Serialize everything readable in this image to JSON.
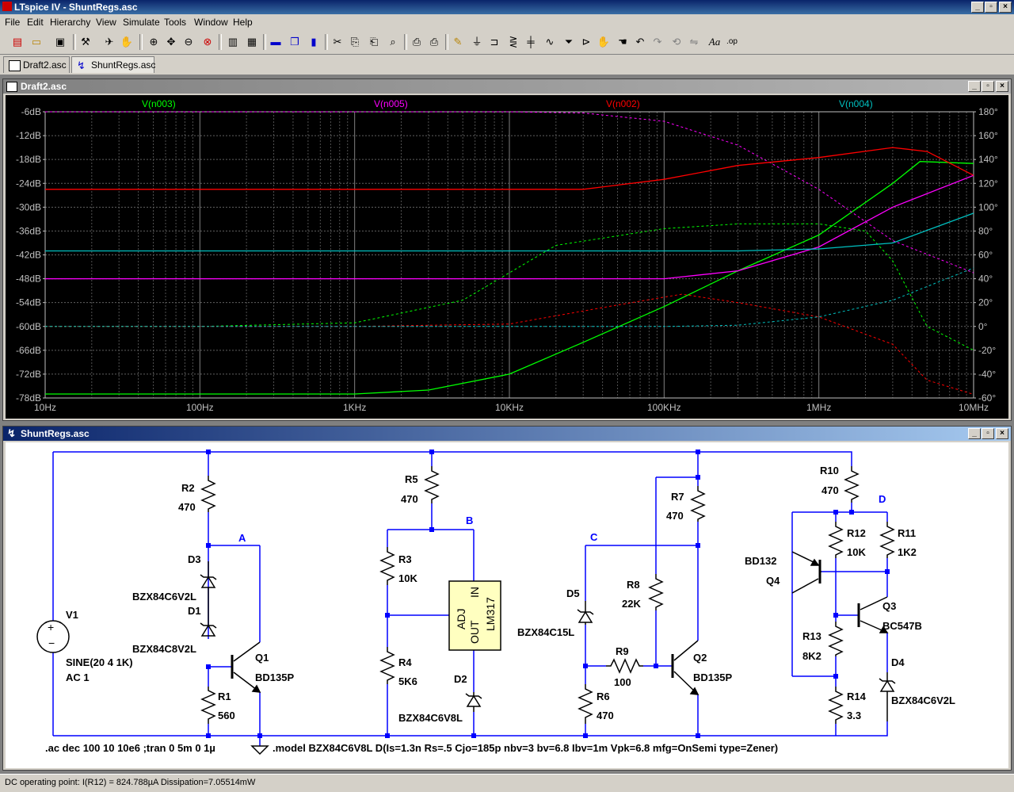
{
  "app": {
    "title": "LTspice IV - ShuntRegs.asc"
  },
  "menu": [
    "File",
    "Edit",
    "Hierarchy",
    "View",
    "Simulate",
    "Tools",
    "Window",
    "Help"
  ],
  "tabs": [
    {
      "label": "Draft2.asc",
      "icon": "waveform-icon"
    },
    {
      "label": "ShuntRegs.asc",
      "icon": "schematic-icon"
    }
  ],
  "plot_window": {
    "title": "Draft2.asc",
    "traces": [
      {
        "label": "V(n003)",
        "color": "#00ff00"
      },
      {
        "label": "V(n005)",
        "color": "#ff00ff"
      },
      {
        "label": "V(n002)",
        "color": "#ff0000"
      },
      {
        "label": "V(n004)",
        "color": "#00c0c0"
      }
    ]
  },
  "chart_data": {
    "type": "line",
    "xscale": "log",
    "xlim": [
      10,
      10000000
    ],
    "x_ticks": [
      "10Hz",
      "100Hz",
      "1KHz",
      "10KHz",
      "100KHz",
      "1MHz",
      "10MHz"
    ],
    "y_left_ticks": [
      "-6dB",
      "-12dB",
      "-18dB",
      "-24dB",
      "-30dB",
      "-36dB",
      "-42dB",
      "-48dB",
      "-54dB",
      "-60dB",
      "-66dB",
      "-72dB",
      "-78dB"
    ],
    "y_left_lim": [
      -78,
      -6
    ],
    "y_right_ticks": [
      "180°",
      "160°",
      "140°",
      "120°",
      "100°",
      "80°",
      "60°",
      "40°",
      "20°",
      "0°",
      "-20°",
      "-40°",
      "-60°"
    ],
    "y_right_lim": [
      -60,
      180
    ],
    "series": [
      {
        "name": "V(n003)",
        "color": "#00ff00",
        "style": "solid",
        "axis": "dB",
        "x": [
          10,
          1000,
          3000,
          10000,
          30000,
          100000,
          300000,
          1000000,
          3000000,
          4500000,
          10000000
        ],
        "y": [
          -77,
          -77,
          -76,
          -72,
          -64,
          -55,
          -46,
          -37,
          -24,
          -18.5,
          -19
        ]
      },
      {
        "name": "V(n003)",
        "color": "#00ff00",
        "style": "dashed",
        "axis": "deg",
        "x": [
          10,
          100,
          1000,
          5000,
          20000,
          100000,
          300000,
          1000000,
          2000000,
          3000000,
          5000000,
          10000000
        ],
        "y": [
          0,
          0,
          3,
          22,
          68,
          82,
          86,
          86,
          80,
          55,
          0,
          -20
        ]
      },
      {
        "name": "V(n005)",
        "color": "#ff00ff",
        "style": "solid",
        "axis": "dB",
        "x": [
          10,
          100000,
          300000,
          1000000,
          3000000,
          10000000
        ],
        "y": [
          -48,
          -48,
          -46,
          -40,
          -30,
          -22
        ]
      },
      {
        "name": "V(n005)",
        "color": "#ff00ff",
        "style": "dashed",
        "axis": "deg",
        "x": [
          10,
          1000,
          10000,
          30000,
          100000,
          300000,
          1000000,
          3000000,
          10000000
        ],
        "y": [
          180,
          180,
          180,
          179,
          172,
          152,
          115,
          72,
          45
        ]
      },
      {
        "name": "V(n002)",
        "color": "#ff0000",
        "style": "solid",
        "axis": "dB",
        "x": [
          10,
          30000,
          100000,
          300000,
          1000000,
          3000000,
          5000000,
          10000000
        ],
        "y": [
          -25.5,
          -25.5,
          -23,
          -19.5,
          -17.5,
          -15,
          -16,
          -22
        ]
      },
      {
        "name": "V(n002)",
        "color": "#ff0000",
        "style": "dashed",
        "axis": "deg",
        "x": [
          10,
          1000,
          10000,
          50000,
          130000,
          300000,
          1000000,
          3000000,
          5000000,
          10000000
        ],
        "y": [
          0,
          0,
          2,
          18,
          27,
          20,
          8,
          -15,
          -45,
          -57
        ]
      },
      {
        "name": "V(n004)",
        "color": "#00c0c0",
        "style": "solid",
        "axis": "dB",
        "x": [
          10,
          300000,
          1000000,
          3000000,
          10000000
        ],
        "y": [
          -41,
          -41,
          -40.5,
          -39,
          -31.5
        ]
      },
      {
        "name": "V(n004)",
        "color": "#00c0c0",
        "style": "dashed",
        "axis": "deg",
        "x": [
          10,
          100000,
          300000,
          1000000,
          3000000,
          10000000
        ],
        "y": [
          0,
          0,
          1,
          8,
          22,
          49
        ]
      }
    ]
  },
  "schematic_window": {
    "title": "ShuntRegs.asc",
    "components": [
      {
        "id": "R2",
        "value": "470"
      },
      {
        "id": "D3",
        "value": "BZX84C6V2L"
      },
      {
        "id": "D1",
        "value": "BZX84C8V2L"
      },
      {
        "id": "Q1",
        "value": "BD135P"
      },
      {
        "id": "R1",
        "value": "560"
      },
      {
        "id": "V1",
        "value": "SINE(20 4 1K)",
        "value2": "AC 1"
      },
      {
        "id": "R5",
        "value": "470"
      },
      {
        "id": "R3",
        "value": "10K"
      },
      {
        "id": "R4",
        "value": "5K6"
      },
      {
        "id": "D2",
        "value": "BZX84C6V8L"
      },
      {
        "id": "LM317",
        "pins": [
          "ADJ",
          "OUT",
          "IN"
        ],
        "value": "LM317"
      },
      {
        "id": "R7",
        "value": "470"
      },
      {
        "id": "R8",
        "value": "22K"
      },
      {
        "id": "D5",
        "value": "BZX84C15L"
      },
      {
        "id": "R9",
        "value": "100"
      },
      {
        "id": "Q2",
        "value": "BD135P"
      },
      {
        "id": "R6",
        "value": "470"
      },
      {
        "id": "R10",
        "value": "470"
      },
      {
        "id": "R12",
        "value": "10K"
      },
      {
        "id": "R11",
        "value": "1K2"
      },
      {
        "id": "Q4",
        "value": "BD132"
      },
      {
        "id": "Q3",
        "value": "BC547B"
      },
      {
        "id": "R13",
        "value": "8K2"
      },
      {
        "id": "D4",
        "value": "BZX84C6V2L"
      },
      {
        "id": "R14",
        "value": "3.3"
      }
    ],
    "nodes": [
      "A",
      "B",
      "C",
      "D"
    ],
    "directive_ac": ".ac dec 100 10 10e6  ;tran 0 5m 0 1µ",
    "directive_model": ".model BZX84C6V8L D(Is=1.3n Rs=.5 Cjo=185p nbv=3 bv=6.8 Ibv=1m Vpk=6.8 mfg=OnSemi type=Zener)"
  },
  "status": {
    "text": "DC operating point: I(R12) = 824.788µA  Dissipation=7.05514mW"
  }
}
